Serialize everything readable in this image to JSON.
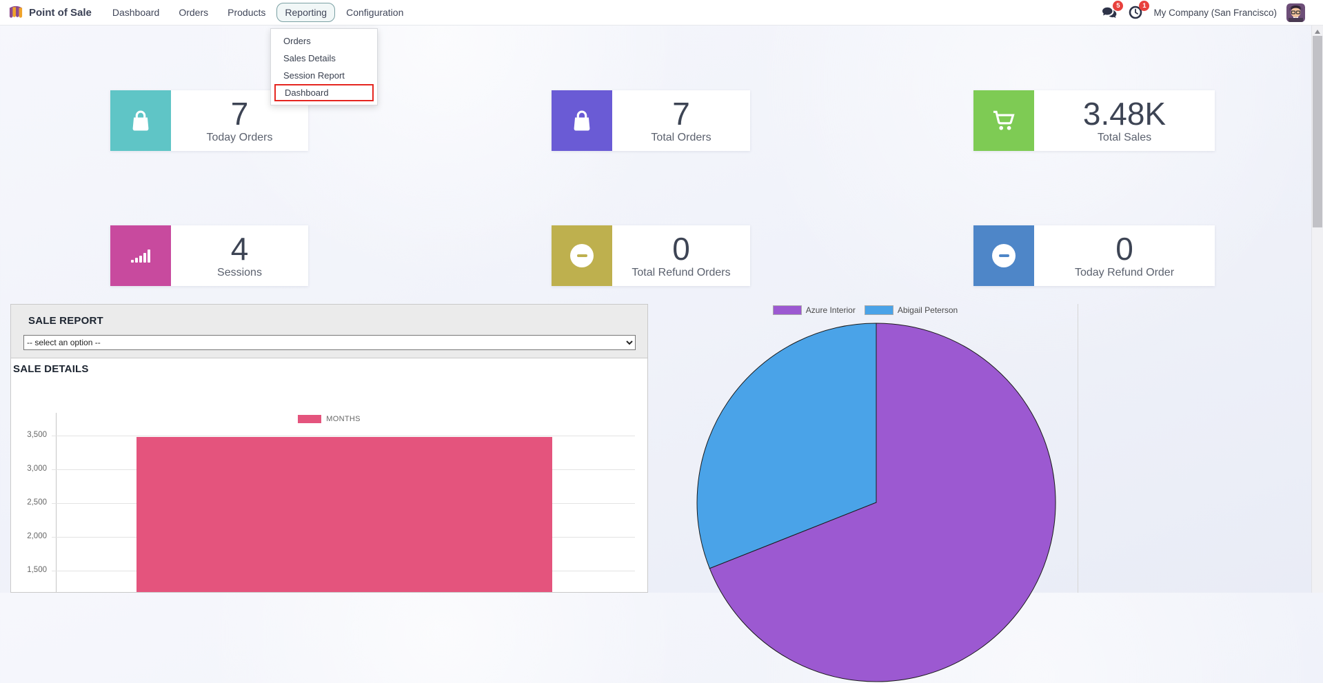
{
  "navbar": {
    "app_title": "Point of Sale",
    "items": [
      {
        "label": "Dashboard",
        "active": false
      },
      {
        "label": "Orders",
        "active": false
      },
      {
        "label": "Products",
        "active": false
      },
      {
        "label": "Reporting",
        "active": true
      },
      {
        "label": "Configuration",
        "active": false
      }
    ],
    "messages_badge": "5",
    "activities_badge": "1",
    "company_name": "My Company (San Francisco)"
  },
  "reporting_menu": {
    "items": [
      {
        "label": "Orders",
        "highlighted": false
      },
      {
        "label": "Sales Details",
        "highlighted": false
      },
      {
        "label": "Session Report",
        "highlighted": false
      },
      {
        "label": "Dashboard",
        "highlighted": true
      }
    ],
    "highlight_color": "#e5251f"
  },
  "kpi_cards": [
    {
      "value": "7",
      "label": "Today Orders",
      "icon": "shopping-bag-icon",
      "color": "#5fc5c6"
    },
    {
      "value": "7",
      "label": "Total Orders",
      "icon": "shopping-bag-icon",
      "color": "#6a5bd5"
    },
    {
      "value": "3.48K",
      "label": "Total Sales",
      "icon": "shopping-cart-icon",
      "color": "#7ecb54"
    },
    {
      "value": "4",
      "label": "Sessions",
      "icon": "bar-signal-icon",
      "color": "#c84a9e"
    },
    {
      "value": "0",
      "label": "Total Refund Orders",
      "icon": "minus-circle-icon",
      "color": "#beb04e"
    },
    {
      "value": "0",
      "label": "Today Refund Order",
      "icon": "minus-circle-icon",
      "color": "#4e86c8"
    }
  ],
  "sale_report": {
    "title": "SALE REPORT",
    "select_value": "-- select an option --"
  },
  "sale_details_title": "SALE DETAILS",
  "chart_data": [
    {
      "type": "bar",
      "title": "SALE DETAILS",
      "categories": [
        ""
      ],
      "series": [
        {
          "name": "MONTHS",
          "values": [
            3480
          ],
          "color": "#e4547d"
        }
      ],
      "yticks": [
        {
          "label": "3,500",
          "value": 3500
        },
        {
          "label": "3,000",
          "value": 3000
        },
        {
          "label": "2,500",
          "value": 2500
        },
        {
          "label": "2,000",
          "value": 2000
        },
        {
          "label": "1,500",
          "value": 1500
        }
      ],
      "ylim_visible": [
        1500,
        3500
      ],
      "grid": true,
      "legend_position": "top"
    },
    {
      "type": "pie",
      "slices": [
        {
          "label": "Azure Interior",
          "color": "#9c59d1",
          "percent": 69
        },
        {
          "label": "Abigail Peterson",
          "color": "#4aa3e8",
          "percent": 31
        }
      ],
      "legend_position": "top"
    }
  ]
}
